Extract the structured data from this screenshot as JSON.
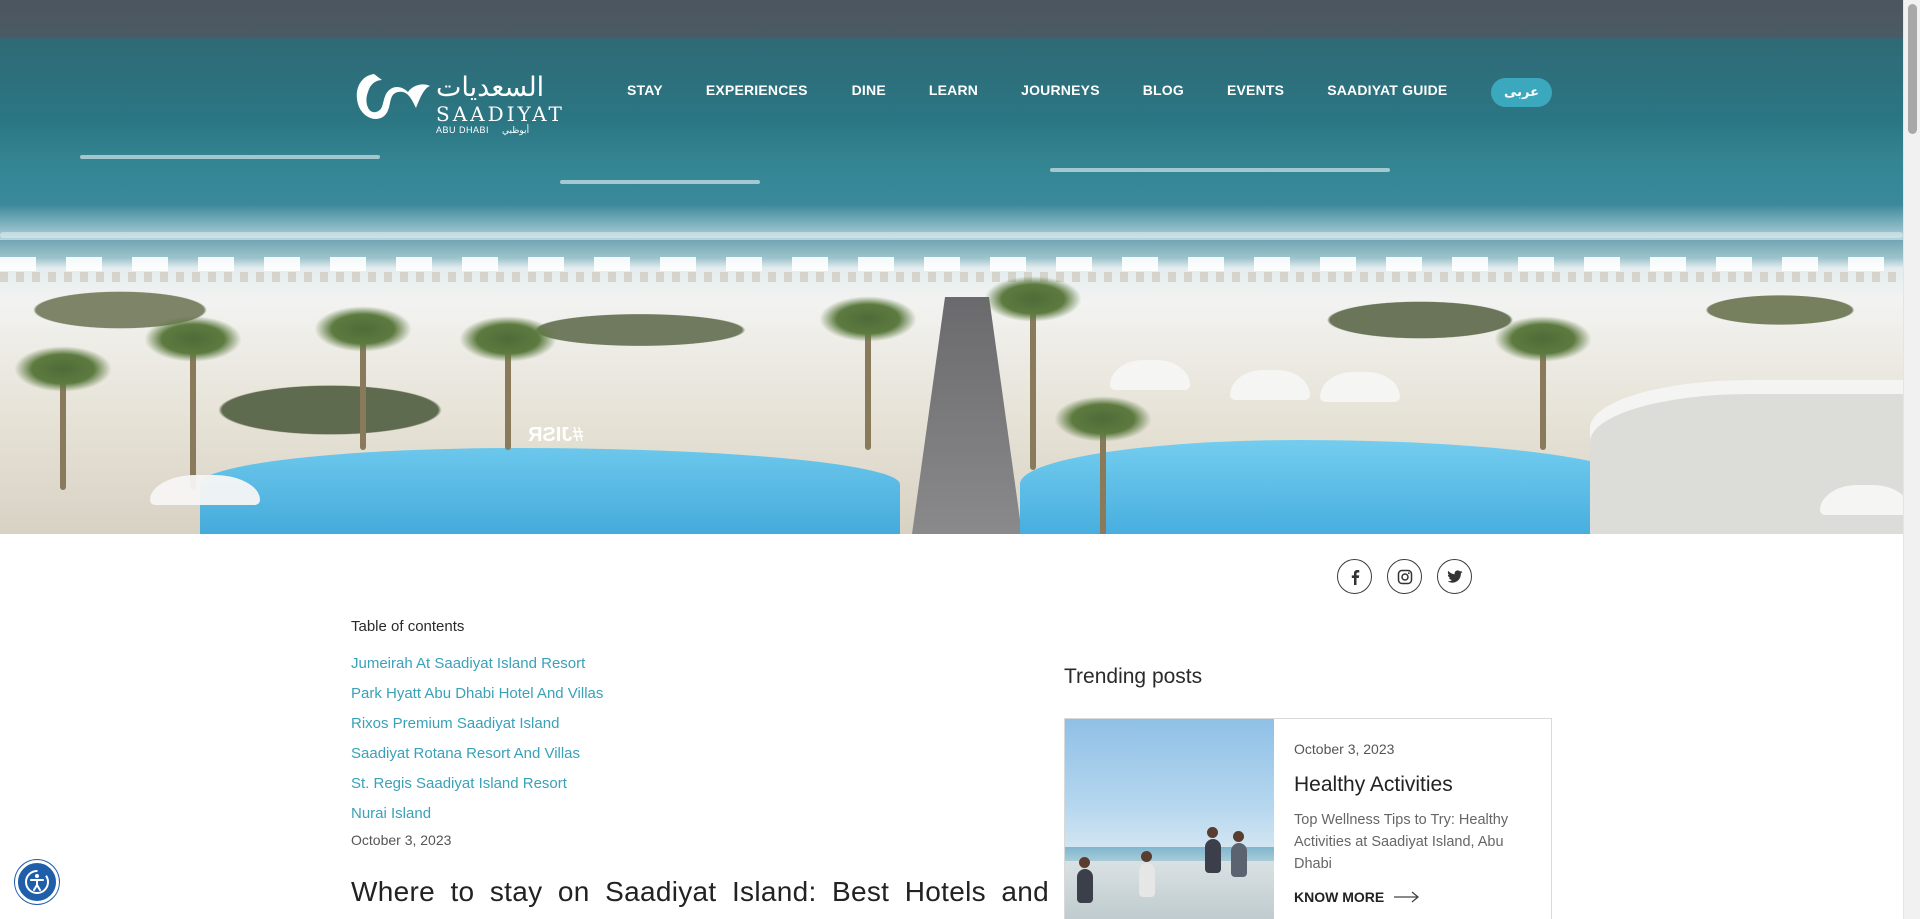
{
  "logo": {
    "arabic": "السعديات",
    "english": "SAADIYAT",
    "sub_en": "ABU DHABI",
    "sub_ar": "أبوظبي"
  },
  "nav": {
    "items": [
      {
        "label": "STAY"
      },
      {
        "label": "EXPERIENCES"
      },
      {
        "label": "DINE"
      },
      {
        "label": "LEARN"
      },
      {
        "label": "JOURNEYS"
      },
      {
        "label": "BLOG"
      },
      {
        "label": "EVENTS"
      },
      {
        "label": "SAADIYAT GUIDE"
      }
    ],
    "language_button": "عربى"
  },
  "hero": {
    "sign_text": "#JISR"
  },
  "social": {
    "icons": [
      "facebook-icon",
      "instagram-icon",
      "twitter-icon"
    ]
  },
  "toc": {
    "title": "Table of contents",
    "items": [
      "Jumeirah At Saadiyat Island Resort",
      "Park Hyatt Abu Dhabi Hotel And Villas",
      "Rixos Premium Saadiyat Island",
      "Saadiyat Rotana Resort And Villas",
      "St. Regis Saadiyat Island Resort",
      "Nurai Island"
    ]
  },
  "post": {
    "date": "October 3, 2023",
    "title": "Where to stay on Saadiyat Island: Best Hotels and"
  },
  "trending": {
    "title": "Trending posts",
    "card": {
      "date": "October 3, 2023",
      "title": "Healthy Activities",
      "description": "Top Wellness Tips to Try: Healthy Activities at Saadiyat Island, Abu Dhabi",
      "cta": "KNOW MORE"
    }
  },
  "colors": {
    "accent": "#3ba8bd",
    "link": "#3aa1b8",
    "accessibility": "#1f5ea8"
  }
}
